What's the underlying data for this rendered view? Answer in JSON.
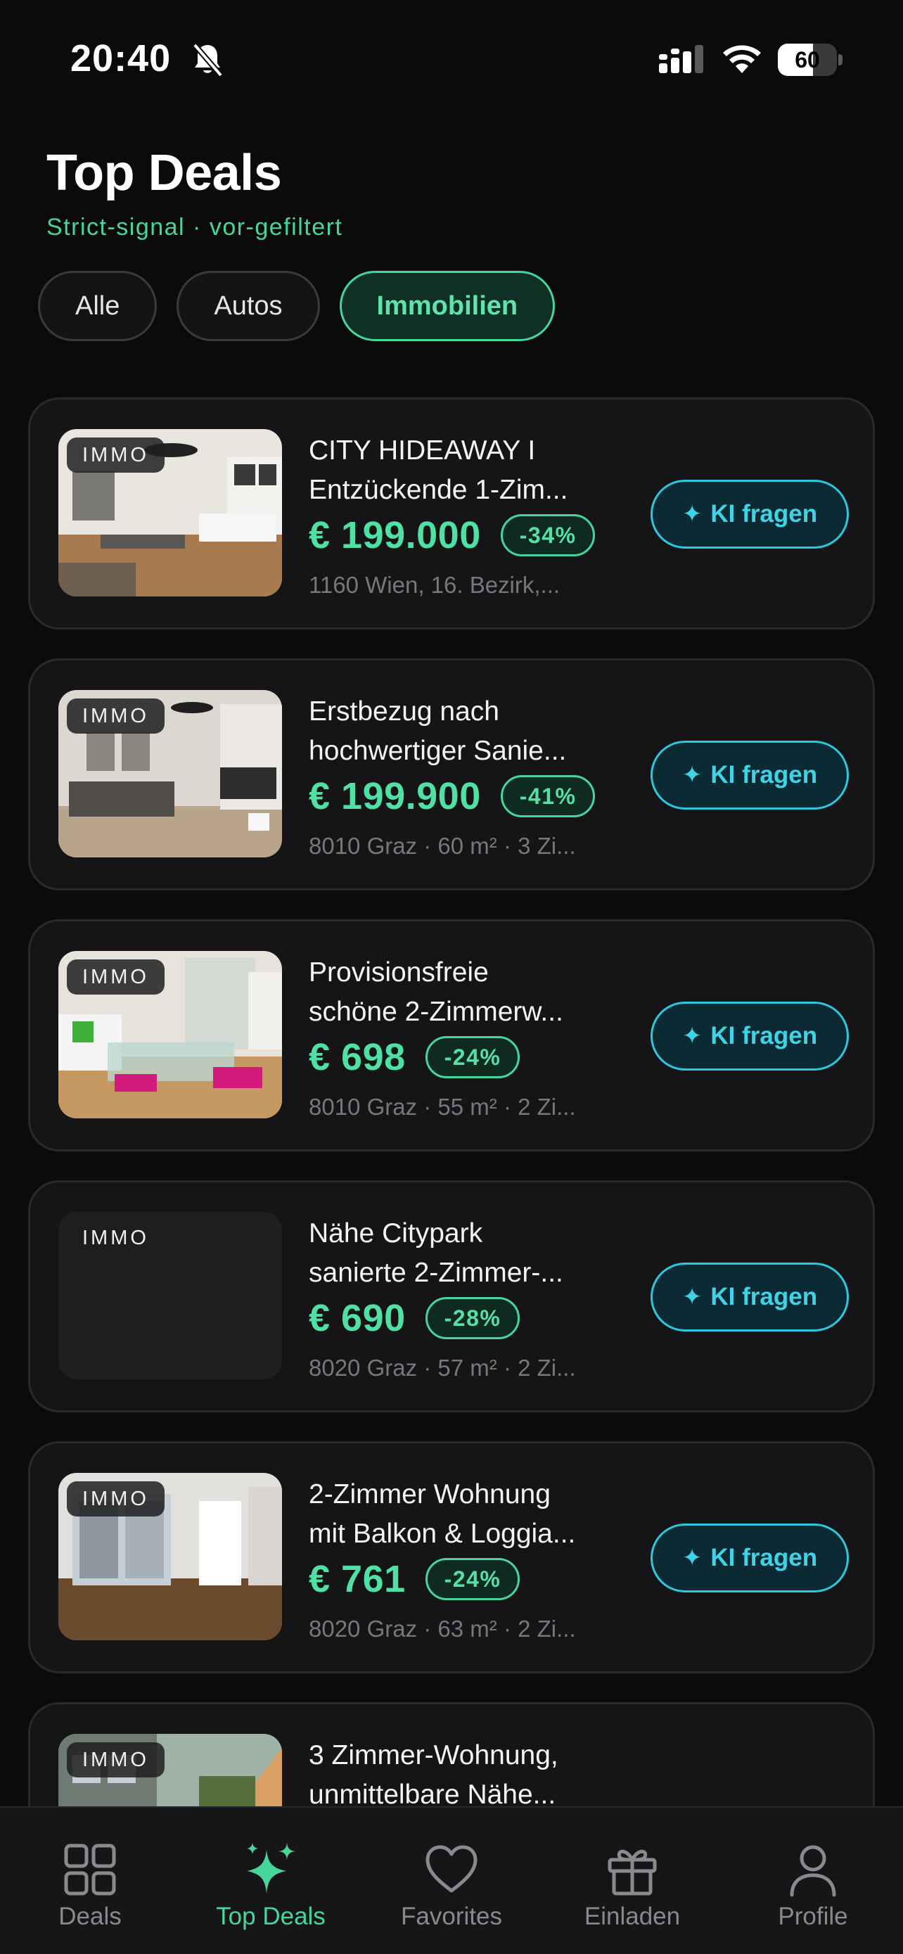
{
  "status_bar": {
    "time": "20:40",
    "battery": "60",
    "battery_level": 0.6
  },
  "header": {
    "title": "Top Deals",
    "subtitle": "Strict-signal · vor-gefiltert"
  },
  "filters": [
    {
      "label": "Alle",
      "active": false
    },
    {
      "label": "Autos",
      "active": false
    },
    {
      "label": "Immobilien",
      "active": true
    }
  ],
  "deals": [
    {
      "badge": "IMMO",
      "title_line1": "CITY HIDEAWAY I",
      "title_line2": "Entzückende 1-Zim...",
      "price": "€ 199.000",
      "discount": "-34%",
      "location": "1160 Wien, 16. Bezirk,...",
      "action": "KI fragen"
    },
    {
      "badge": "IMMO",
      "title_line1": "Erstbezug nach",
      "title_line2": "hochwertiger Sanie...",
      "price": "€ 199.900",
      "discount": "-41%",
      "location": "8010 Graz · 60 m² · 3 Zi...",
      "action": "KI fragen"
    },
    {
      "badge": "IMMO",
      "title_line1": "Provisionsfreie",
      "title_line2": "schöne 2-Zimmerw...",
      "price": "€ 698",
      "discount": "-24%",
      "location": "8010 Graz · 55 m² · 2 Zi...",
      "action": "KI fragen"
    },
    {
      "badge": "IMMO",
      "title_line1": "Nähe Citypark",
      "title_line2": "sanierte 2-Zimmer-...",
      "price": "€ 690",
      "discount": "-28%",
      "location": "8020 Graz · 57 m² · 2 Zi...",
      "action": "KI fragen"
    },
    {
      "badge": "IMMO",
      "title_line1": "2-Zimmer Wohnung",
      "title_line2": "mit Balkon & Loggia...",
      "price": "€ 761",
      "discount": "-24%",
      "location": "8020 Graz · 63 m² · 2 Zi...",
      "action": "KI fragen"
    },
    {
      "badge": "IMMO",
      "title_line1": "3 Zimmer-Wohnung,",
      "title_line2": "unmittelbare Nähe...",
      "price": "",
      "discount": "",
      "location": "",
      "action": ""
    }
  ],
  "tabs": [
    {
      "label": "Deals",
      "icon": "grid-icon",
      "active": false
    },
    {
      "label": "Top Deals",
      "icon": "sparkles-icon",
      "active": true
    },
    {
      "label": "Favorites",
      "icon": "heart-icon",
      "active": false
    },
    {
      "label": "Einladen",
      "icon": "gift-icon",
      "active": false
    },
    {
      "label": "Profile",
      "icon": "person-icon",
      "active": false
    }
  ],
  "colors": {
    "accent_green": "#46d69a",
    "accent_cyan": "#2cc8dd",
    "background": "#0b0b0c",
    "card": "#151517"
  }
}
